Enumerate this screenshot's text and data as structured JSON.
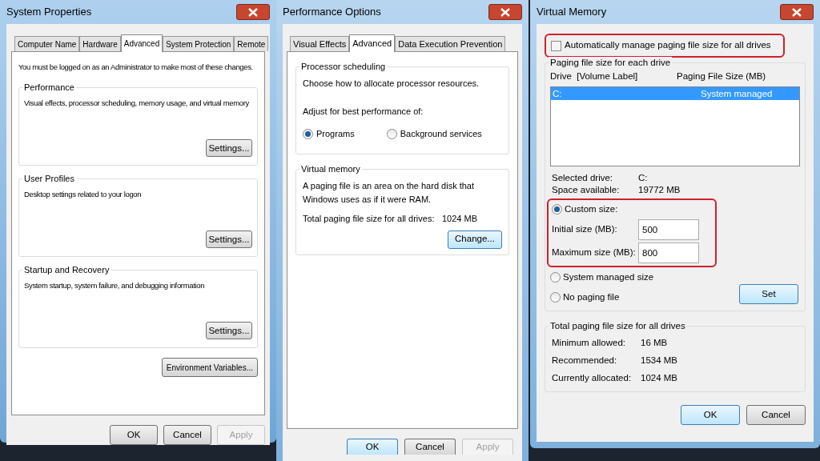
{
  "system_properties": {
    "title": "System Properties",
    "tabs": [
      {
        "label": "Computer Name",
        "selected": false
      },
      {
        "label": "Hardware",
        "selected": false
      },
      {
        "label": "Advanced",
        "selected": true
      },
      {
        "label": "System Protection",
        "selected": false
      },
      {
        "label": "Remote",
        "selected": false
      }
    ],
    "note": "You must be logged on as an Administrator to make most of these changes.",
    "groups": [
      {
        "heading": "Performance",
        "description": "Visual effects, processor scheduling, memory usage, and virtual memory",
        "button": "Settings..."
      },
      {
        "heading": "User Profiles",
        "description": "Desktop settings related to your logon",
        "button": "Settings..."
      },
      {
        "heading": "Startup and Recovery",
        "description": "System startup, system failure, and debugging information",
        "button": "Settings..."
      }
    ],
    "extra_button": "Environment Variables...",
    "footer_buttons": [
      {
        "label": "OK",
        "disabled": false
      },
      {
        "label": "Cancel",
        "disabled": false
      },
      {
        "label": "Apply",
        "disabled": true
      }
    ]
  },
  "performance_options": {
    "title": "Performance Options",
    "tabs": [
      {
        "label": "Visual Effects",
        "selected": false
      },
      {
        "label": "Advanced",
        "selected": true
      },
      {
        "label": "Data Execution Prevention",
        "selected": false
      }
    ],
    "processor_scheduling": {
      "heading": "Processor scheduling",
      "description": "Choose how to allocate processor resources.",
      "prompt": "Adjust for best performance of:",
      "options": [
        {
          "label": "Programs",
          "selected": true
        },
        {
          "label": "Background services",
          "selected": false
        }
      ]
    },
    "virtual_memory": {
      "heading": "Virtual memory",
      "description": "A paging file is an area on the hard disk that Windows uses as if it were RAM.",
      "total_label": "Total paging file size for all drives:",
      "total_value": "1024 MB",
      "button": "Change..."
    },
    "footer_buttons": [
      {
        "label": "OK",
        "disabled": false
      },
      {
        "label": "Cancel",
        "disabled": false
      },
      {
        "label": "Apply",
        "disabled": true
      }
    ]
  },
  "virtual_memory": {
    "title": "Virtual Memory",
    "auto_manage": {
      "label": "Automatically manage paging file size for all drives",
      "checked": false,
      "highlighted": true
    },
    "drives": {
      "heading": "Paging file size for each drive",
      "columns": [
        "Drive  [Volume Label]",
        "Paging File Size (MB)"
      ],
      "rows": [
        {
          "drive": "C:",
          "size": "System managed",
          "selected": true
        }
      ],
      "info": [
        {
          "label": "Selected drive:",
          "value": "C:"
        },
        {
          "label": "Space available:",
          "value": "19772 MB"
        }
      ],
      "custom": {
        "label": "Custom size:",
        "selected": true,
        "highlighted": true,
        "fields": [
          {
            "label": "Initial size (MB):",
            "value": "500"
          },
          {
            "label": "Maximum size (MB):",
            "value": "800"
          }
        ]
      },
      "other_options": [
        {
          "label": "System managed size",
          "selected": false
        },
        {
          "label": "No paging file",
          "selected": false
        }
      ],
      "set_button": "Set"
    },
    "totals": {
      "heading": "Total paging file size for all drives",
      "rows": [
        {
          "label": "Minimum allowed:",
          "value": "16 MB"
        },
        {
          "label": "Recommended:",
          "value": "1534 MB"
        },
        {
          "label": "Currently allocated:",
          "value": "1024 MB"
        }
      ]
    },
    "footer_buttons": [
      {
        "label": "OK",
        "default": true
      },
      {
        "label": "Cancel",
        "default": false
      }
    ]
  }
}
